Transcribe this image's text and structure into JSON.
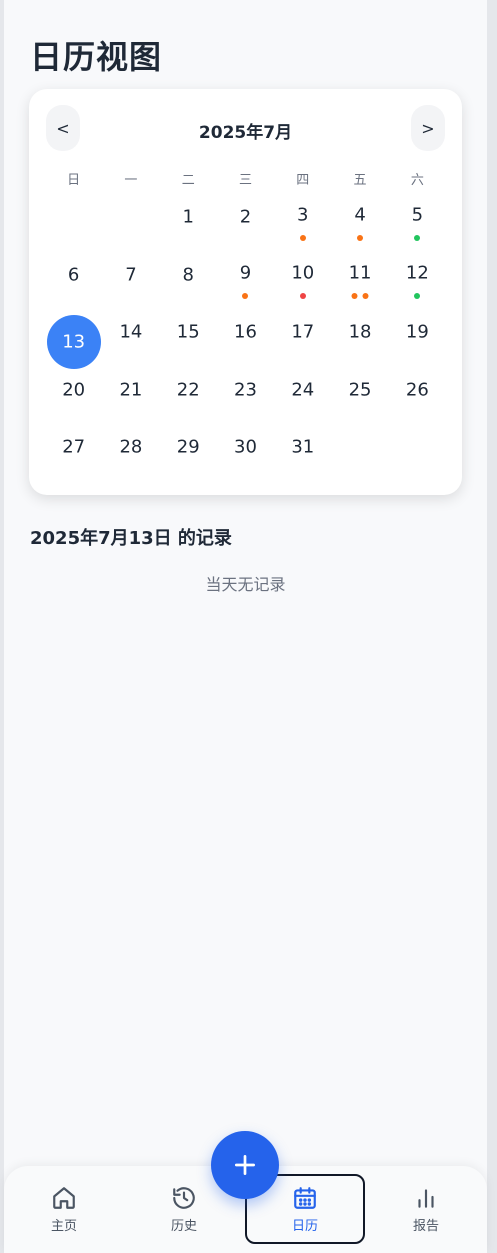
{
  "page": {
    "title": "日历视图"
  },
  "calendar": {
    "month_label": "2025年7月",
    "prev_label": "<",
    "next_label": ">",
    "weekdays": [
      "日",
      "一",
      "二",
      "三",
      "四",
      "五",
      "六"
    ],
    "leading_blanks": 2,
    "days": [
      {
        "n": "1",
        "dots": []
      },
      {
        "n": "2",
        "dots": []
      },
      {
        "n": "3",
        "dots": [
          "#f97316"
        ]
      },
      {
        "n": "4",
        "dots": [
          "#f97316"
        ]
      },
      {
        "n": "5",
        "dots": [
          "#22c55e"
        ]
      },
      {
        "n": "6",
        "dots": []
      },
      {
        "n": "7",
        "dots": []
      },
      {
        "n": "8",
        "dots": []
      },
      {
        "n": "9",
        "dots": [
          "#f97316"
        ]
      },
      {
        "n": "10",
        "dots": [
          "#ef4444"
        ]
      },
      {
        "n": "11",
        "dots": [
          "#f97316",
          "#f97316"
        ]
      },
      {
        "n": "12",
        "dots": [
          "#22c55e"
        ]
      },
      {
        "n": "13",
        "dots": [],
        "selected": true
      },
      {
        "n": "14",
        "dots": []
      },
      {
        "n": "15",
        "dots": []
      },
      {
        "n": "16",
        "dots": []
      },
      {
        "n": "17",
        "dots": []
      },
      {
        "n": "18",
        "dots": []
      },
      {
        "n": "19",
        "dots": []
      },
      {
        "n": "20",
        "dots": []
      },
      {
        "n": "21",
        "dots": []
      },
      {
        "n": "22",
        "dots": []
      },
      {
        "n": "23",
        "dots": []
      },
      {
        "n": "24",
        "dots": []
      },
      {
        "n": "25",
        "dots": []
      },
      {
        "n": "26",
        "dots": []
      },
      {
        "n": "27",
        "dots": []
      },
      {
        "n": "28",
        "dots": []
      },
      {
        "n": "29",
        "dots": []
      },
      {
        "n": "30",
        "dots": []
      },
      {
        "n": "31",
        "dots": []
      }
    ]
  },
  "records": {
    "title": "2025年7月13日 的记录",
    "empty_text": "当天无记录"
  },
  "fab": {
    "icon": "plus-icon"
  },
  "tabs": [
    {
      "label": "主页",
      "icon": "home-icon"
    },
    {
      "label": "历史",
      "icon": "history-icon"
    },
    {
      "label": "日历",
      "icon": "calendar-icon",
      "active": true
    },
    {
      "label": "报告",
      "icon": "bar-chart-icon"
    }
  ],
  "colors": {
    "accent": "#2563eb",
    "selected_day": "#3b82f6",
    "dot_orange": "#f97316",
    "dot_green": "#22c55e",
    "dot_red": "#ef4444"
  }
}
